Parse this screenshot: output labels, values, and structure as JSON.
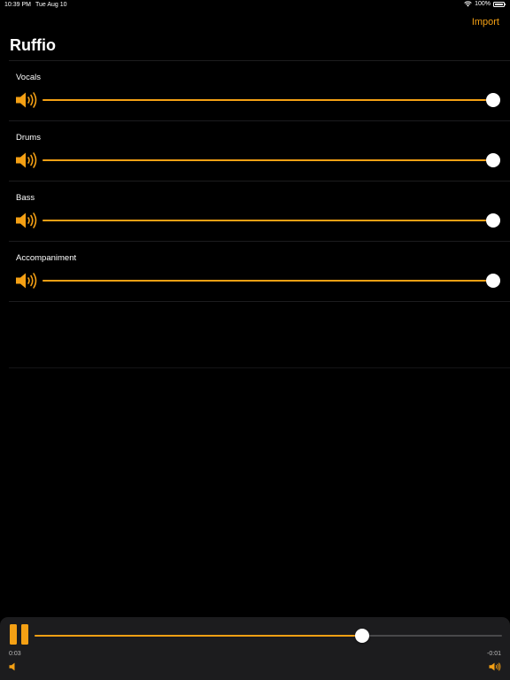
{
  "status": {
    "time": "10:39 PM",
    "date": "Tue Aug 10",
    "battery": "100%"
  },
  "header": {
    "import_label": "Import",
    "title": "Ruffio"
  },
  "tracks": [
    {
      "label": "Vocals",
      "volume": 1.0
    },
    {
      "label": "Drums",
      "volume": 1.0
    },
    {
      "label": "Bass",
      "volume": 1.0
    },
    {
      "label": "Accompaniment",
      "volume": 1.0
    }
  ],
  "player": {
    "elapsed": "0:03",
    "remaining": "-0:01",
    "progress": 0.7
  },
  "colors": {
    "accent": "#f4a014",
    "background": "#000000",
    "player_bg": "#1c1c1e"
  },
  "icons": {
    "track_icon": "speaker-wave-icon",
    "play_state_icon": "pause-icon"
  }
}
